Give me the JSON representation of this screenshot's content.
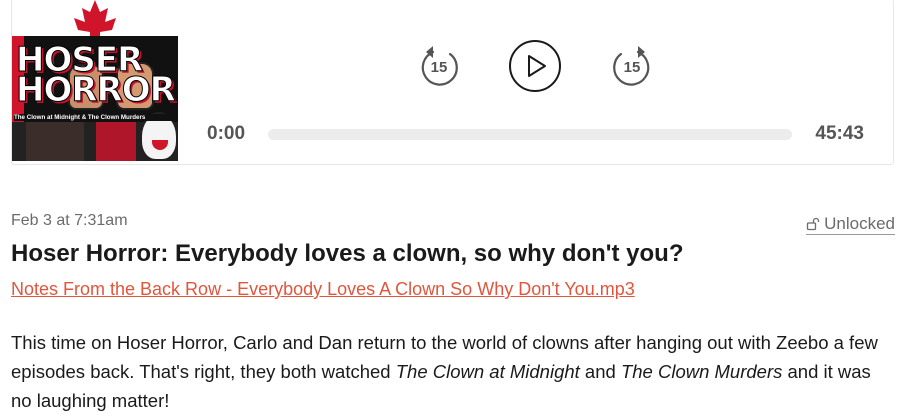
{
  "player": {
    "artwork": {
      "logo_line1": "HOSER",
      "logo_line2": "HORROR",
      "caption": "The Clown at Midnight & The Clown Murders"
    },
    "skip_back_label": "15",
    "skip_forward_label": "15",
    "current_time": "0:00",
    "duration": "45:43",
    "progress": 0,
    "colors": {
      "icon": "#555555",
      "progress_track": "#ececec"
    }
  },
  "post": {
    "date": "Feb 3 at 7:31am",
    "access_label": "Unlocked",
    "title": "Hoser Horror: Everybody loves a clown, so why don't you?",
    "file_link": "Notes From the Back Row - Everybody Loves A Clown So Why Don't You.mp3",
    "description": {
      "part1": "This time on Hoser Horror, Carlo and Dan return to the world of clowns after hanging out with Zeebo a few episodes back. That's right, they both watched ",
      "film1": "The Clown at Midnight",
      "part2": " and ",
      "film2": "The Clown Murders",
      "part3": " and it was no laughing matter!"
    },
    "colors": {
      "link": "#e2553d",
      "meta": "#6b6b6b"
    }
  }
}
